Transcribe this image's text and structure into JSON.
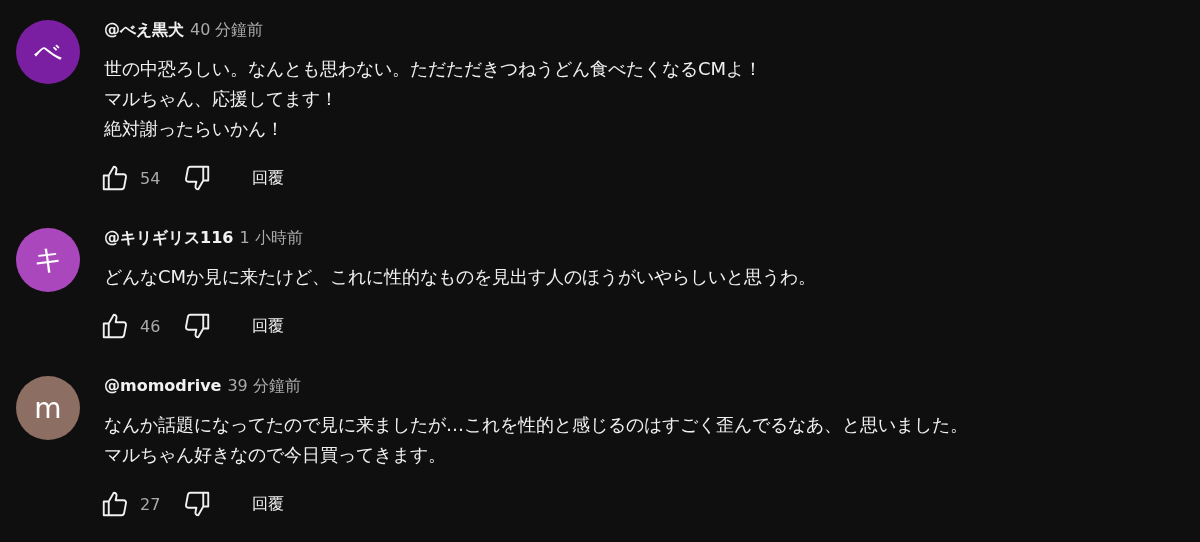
{
  "comments": [
    {
      "avatar": "べ",
      "color": "#7b1fa2",
      "author": "@べえ黒犬",
      "time": "40 分鐘前",
      "lines": [
        "世の中恐ろしい。なんとも思わない。ただただきつねうどん食べたくなるCMよ！",
        "マルちゃん、応援してます！",
        "絶対謝ったらいかん！"
      ],
      "likes": "54",
      "reply": "回覆"
    },
    {
      "avatar": "キ",
      "color": "#ab47bc",
      "author": "@キリギリス116",
      "time": "1 小時前",
      "lines": [
        "どんなCMか見に来たけど、これに性的なものを見出す人のほうがいやらしいと思うわ。"
      ],
      "likes": "46",
      "reply": "回覆"
    },
    {
      "avatar": "m",
      "color": "#8d6e63",
      "author": "@momodrive",
      "time": "39 分鐘前",
      "lines": [
        "なんか話題になってたので見に来ましたが…これを性的と感じるのはすごく歪んでるなあ、と思いました。",
        "マルちゃん好きなので今日買ってきます。"
      ],
      "likes": "27",
      "reply": "回覆"
    }
  ]
}
